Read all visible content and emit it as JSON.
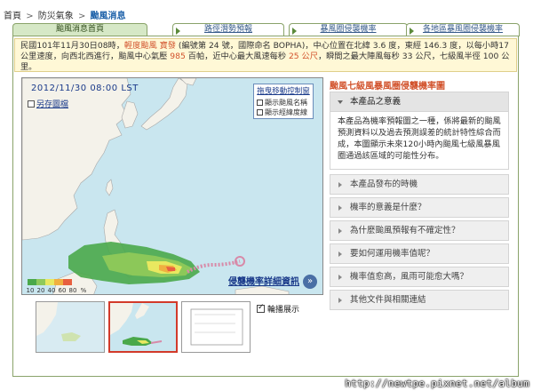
{
  "breadcrumb": {
    "home": "首頁",
    "section": "防災氣象",
    "current": "颱風消息",
    "sep": ">"
  },
  "tabs": [
    {
      "label": "颱風消息首頁",
      "active": true
    },
    {
      "label": "路徑潛勢預報",
      "active": false
    },
    {
      "label": "暴風圈侵襲機率",
      "active": false
    },
    {
      "label": "各地區暴風圈侵襲機率",
      "active": false
    }
  ],
  "info": {
    "p1": "民國101年11月30日08時，",
    "p2": "輕度颱風 寶發",
    "p3": " (編號第 24 號，國際命名 BOPHA)，中心位置在北緯 3.6 度，東經 146.3 度，以每小時17公里速度，向西北西進行，颱風中心氣壓 ",
    "p4": "985",
    "p5": " 百帕，近中心最大風速每秒 ",
    "p6": "25 公尺",
    "p7": "，瞬間之最大陣風每秒 33 公尺，七級風半徑 100 公里。"
  },
  "map": {
    "date": "2012/11/30 08:00 LST",
    "print_label": "另存圖檔",
    "control_title": "拖曳移動控制窗",
    "option_name": "顯示颱風名稱",
    "option_latlon": "顯示經緯度線",
    "legend": [
      "10",
      "20",
      "40",
      "60",
      "80",
      "%"
    ],
    "legend_colors": [
      "#4aa84a",
      "#8fc95a",
      "#e8e860",
      "#f0b040",
      "#e86040"
    ],
    "detail_link": "侵襲機率詳細資訊",
    "close_icon": "»"
  },
  "thumbs": {
    "check_label": "輪播展示"
  },
  "right": {
    "title": "颱風七級風暴風圈侵襲機率圖",
    "items": [
      {
        "label": "本產品之意義",
        "open": true
      },
      {
        "label": "本產品發布的時機",
        "open": false
      },
      {
        "label": "機率的意義是什麼？",
        "open": false
      },
      {
        "label": "為什麼颱風預報有不確定性？",
        "open": false
      },
      {
        "label": "要如何運用機率值呢？",
        "open": false
      },
      {
        "label": "機率值愈高，風雨可能愈大嗎？",
        "open": false
      },
      {
        "label": "其他文件與相關連結",
        "open": false
      }
    ],
    "body": "本產品為機率預報圖之一種，係將最新的颱風預測資料以及過去預測誤差的統計特性綜合而成，本圖顯示未來120小時內颱風七級風暴風圈通過該區域的可能性分布。"
  },
  "watermark": "http://newtpe.pixnet.net/album"
}
